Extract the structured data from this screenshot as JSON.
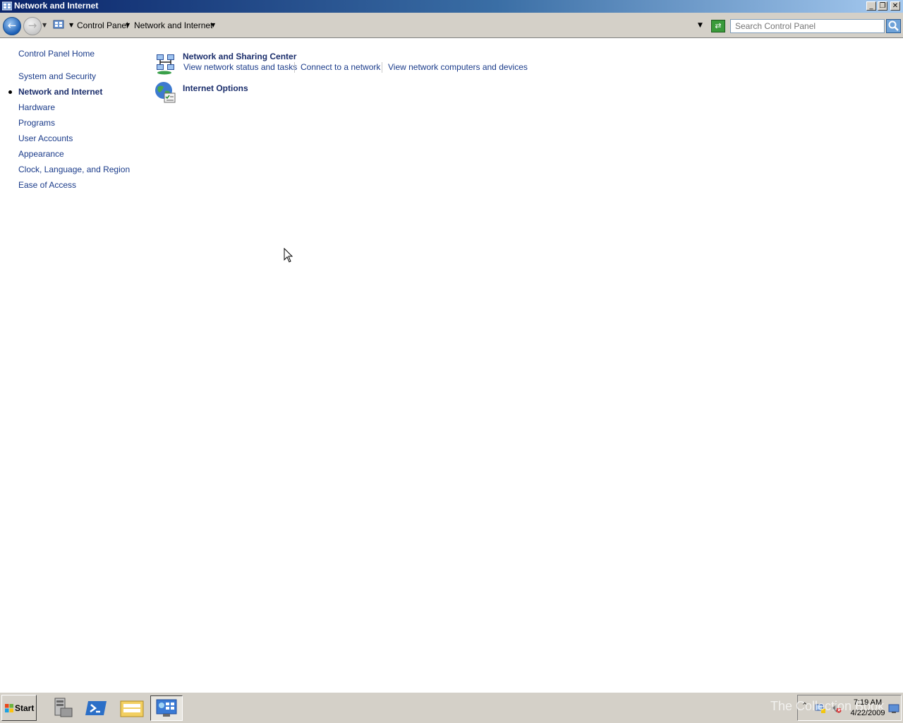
{
  "window": {
    "title": "Network and Internet"
  },
  "breadcrumb": {
    "items": [
      "Control Panel",
      "Network and Internet"
    ]
  },
  "search": {
    "placeholder": "Search Control Panel"
  },
  "left_nav": {
    "items": [
      {
        "label": "Control Panel Home"
      },
      {
        "label": "System and Security"
      },
      {
        "label": "Network and Internet",
        "current": true
      },
      {
        "label": "Hardware"
      },
      {
        "label": "Programs"
      },
      {
        "label": "User Accounts"
      },
      {
        "label": "Appearance"
      },
      {
        "label": "Clock, Language, and Region"
      },
      {
        "label": "Ease of Access"
      }
    ]
  },
  "categories": [
    {
      "title": "Network and Sharing Center",
      "icon": "network-sharing-icon",
      "tasks": [
        "View network status and tasks",
        "Connect to a network",
        "View network computers and devices"
      ]
    },
    {
      "title": "Internet Options",
      "icon": "internet-options-icon",
      "tasks": []
    }
  ],
  "taskbar": {
    "start_label": "Start",
    "watermark": "The Collection Book",
    "clock": {
      "time": "7:19 AM",
      "date": "4/22/2009"
    },
    "pinned": [
      "server-manager-icon",
      "powershell-icon",
      "explorer-icon",
      "control-panel-icon"
    ]
  },
  "colors": {
    "link": "#1a3b8a",
    "heading": "#1a2d6b",
    "titlebar": "#0a246a"
  }
}
